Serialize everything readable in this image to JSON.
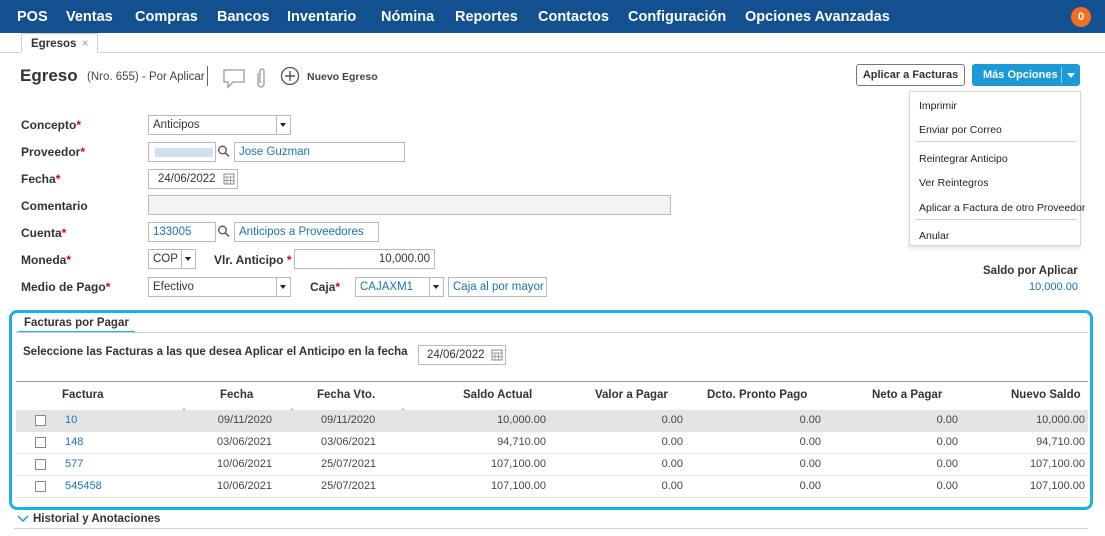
{
  "nav": {
    "items": [
      "POS",
      "Ventas",
      "Compras",
      "Bancos",
      "Inventario",
      "Nómina",
      "Reportes",
      "Contactos",
      "Configuración",
      "Opciones Avanzadas"
    ],
    "notifications": "0"
  },
  "tabs": [
    {
      "label": "Egresos",
      "close": "×"
    }
  ],
  "header": {
    "title": "Egreso",
    "subtitle": "(Nro. 655) - Por Aplicar",
    "new_label": "Nuevo Egreso",
    "apply_button": "Aplicar a Facturas",
    "more_button": "Más Opciones"
  },
  "menu": {
    "items": [
      "Imprimir",
      "Enviar por Correo",
      "Reintegrar Anticipo",
      "Ver Reintegros",
      "Aplicar a Factura de otro Proveedor",
      "Anular"
    ]
  },
  "form": {
    "concepto_label": "Concepto",
    "concepto_value": "Anticipos",
    "proveedor_label": "Proveedor",
    "proveedor_name": "Jose Guzman",
    "fecha_label": "Fecha",
    "fecha_value": "24/06/2022",
    "comentario_label": "Comentario",
    "comentario_value": "",
    "cuenta_label": "Cuenta",
    "cuenta_code": "133005",
    "cuenta_name": "Anticipos a Proveedores",
    "moneda_label": "Moneda",
    "moneda_value": "COP",
    "vlr_label": "Vlr. Anticipo",
    "vlr_value": "10,000.00",
    "medio_label": "Medio de Pago",
    "medio_value": "Efectivo",
    "caja_label": "Caja",
    "caja_value": "CAJAXM1",
    "caja_name": "Caja al por mayor",
    "required_mark": "*"
  },
  "saldo": {
    "label": "Saldo por Aplicar",
    "value": "10,000.00"
  },
  "facturas": {
    "tab_label": "Facturas por Pagar",
    "instruction": "Seleccione las Facturas a las que desea Aplicar el Anticipo en la fecha",
    "date": "24/06/2022",
    "columns": [
      "Factura",
      "Fecha",
      "Fecha Vto.",
      "Saldo Actual",
      "Valor a Pagar",
      "Dcto. Pronto Pago",
      "Neto a Pagar",
      "Nuevo Saldo"
    ],
    "rows": [
      [
        "10",
        "09/11/2020",
        "09/11/2020",
        "10,000.00",
        "0.00",
        "0.00",
        "0.00",
        "10,000.00"
      ],
      [
        "148",
        "03/06/2021",
        "03/06/2021",
        "94,710.00",
        "0.00",
        "0.00",
        "0.00",
        "94,710.00"
      ],
      [
        "577",
        "10/06/2021",
        "25/07/2021",
        "107,100.00",
        "0.00",
        "0.00",
        "0.00",
        "107,100.00"
      ],
      [
        "545458",
        "10/06/2021",
        "25/07/2021",
        "107,100.00",
        "0.00",
        "0.00",
        "0.00",
        "107,100.00"
      ]
    ]
  },
  "historial": {
    "label": "Historial y Anotaciones"
  },
  "colors": {
    "nav_bg": "#12508f",
    "accent": "#1b9ad6",
    "highlight": "#1ab0e8",
    "badge": "#f36f21",
    "link": "#1a73b5",
    "required": "#d0021b"
  },
  "icons": [
    "comment-icon",
    "paperclip-icon",
    "plus-circle-icon",
    "search-icon",
    "calendar-icon",
    "chevron-down-icon"
  ]
}
